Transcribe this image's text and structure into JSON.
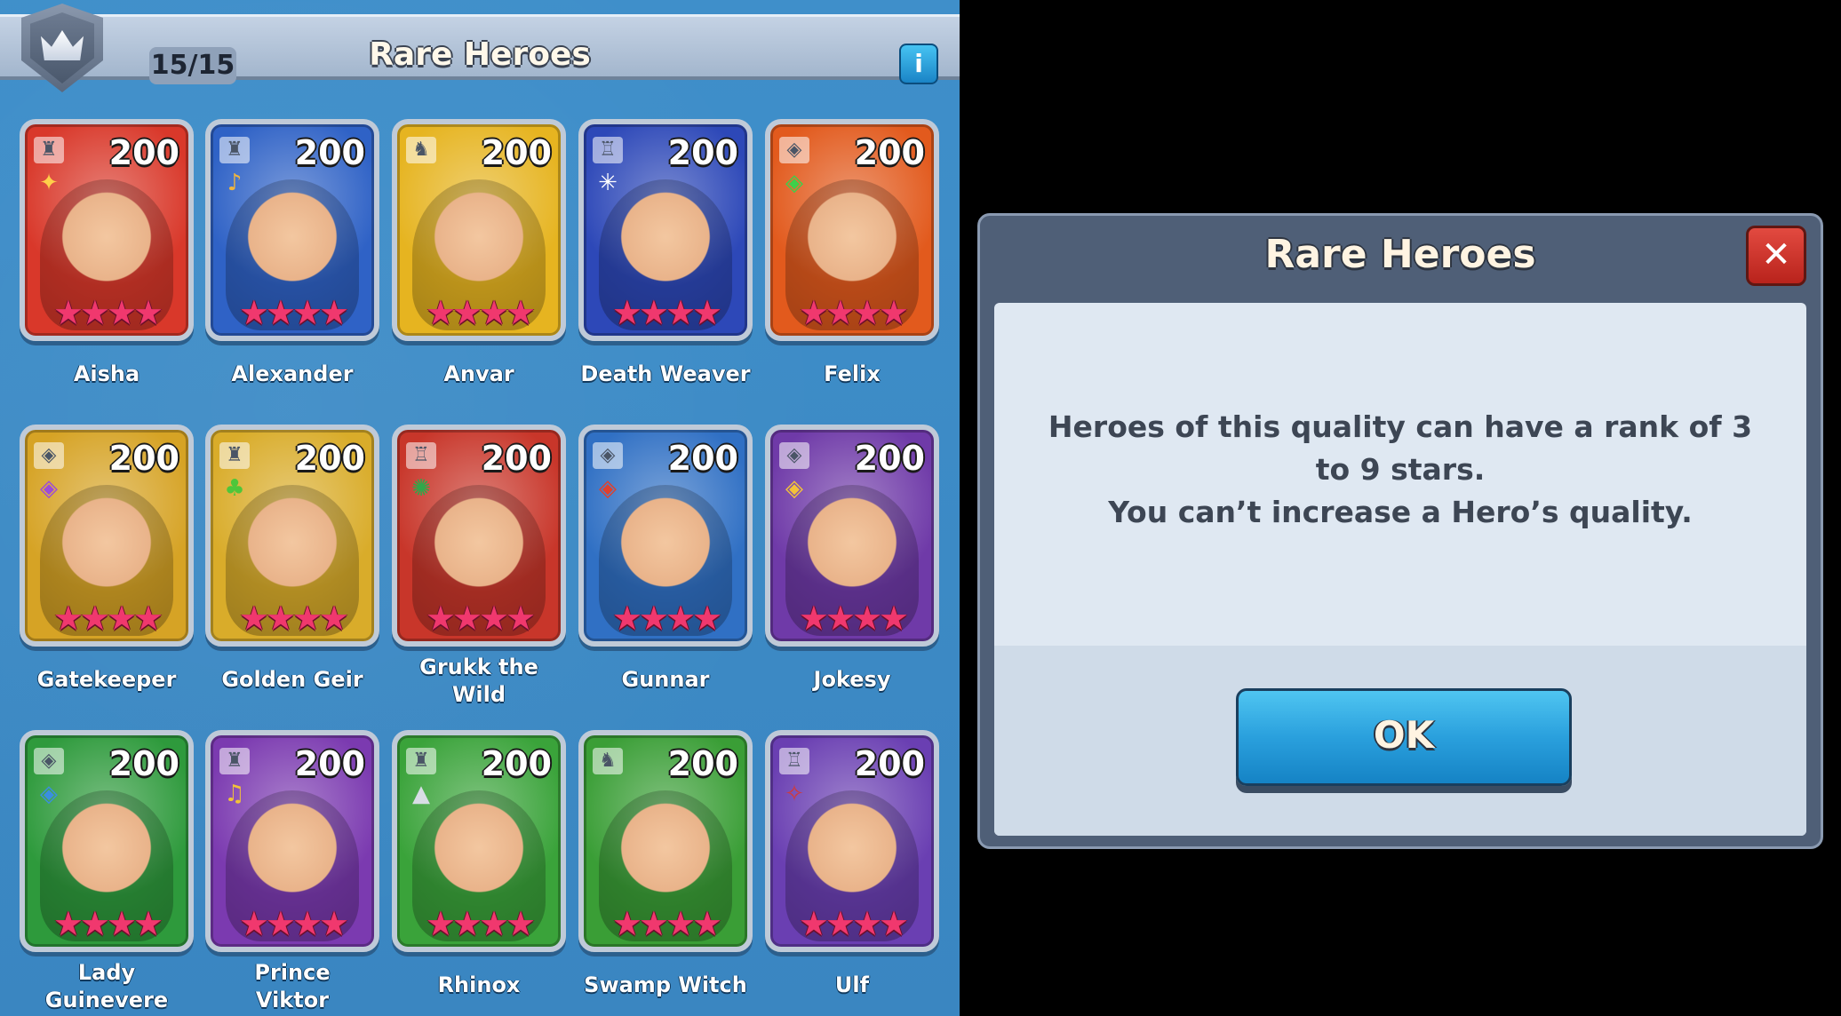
{
  "collection": {
    "title": "Rare Heroes",
    "count": "15/15",
    "info_label": "i",
    "crown_icon": "crown-icon"
  },
  "heroes": [
    {
      "name": "Aisha",
      "power": "200",
      "stars": "★★★★",
      "class_icon": "castle-icon",
      "trait_icon": "sparkle-icon",
      "color": "#d9382a"
    },
    {
      "name": "Alexander",
      "power": "200",
      "stars": "★★★★",
      "class_icon": "castle-icon",
      "trait_icon": "bell-icon",
      "color": "#2f62c6"
    },
    {
      "name": "Anvar",
      "power": "200",
      "stars": "★★★★",
      "class_icon": "knight-icon",
      "trait_icon": "",
      "color": "#e6b420"
    },
    {
      "name": "Death Weaver",
      "power": "200",
      "stars": "★★★★",
      "class_icon": "fortress-icon",
      "trait_icon": "web-icon",
      "color": "#2d48b8"
    },
    {
      "name": "Felix",
      "power": "200",
      "stars": "★★★★",
      "class_icon": "mask-icon",
      "trait_icon": "leaf-mask-icon",
      "color": "#e25a1d"
    },
    {
      "name": "Gatekeeper",
      "power": "200",
      "stars": "★★★★",
      "class_icon": "mask-icon",
      "trait_icon": "purple-mask-icon",
      "color": "#d6a325"
    },
    {
      "name": "Golden Geir",
      "power": "200",
      "stars": "★★★★",
      "class_icon": "castle-icon",
      "trait_icon": "tree-icon",
      "color": "#d9ac2a"
    },
    {
      "name": "Grukk the Wild",
      "power": "200",
      "stars": "★★★★",
      "class_icon": "fortress-icon",
      "trait_icon": "octopus-icon",
      "color": "#c8362a"
    },
    {
      "name": "Gunnar",
      "power": "200",
      "stars": "★★★★",
      "class_icon": "mask-icon",
      "trait_icon": "red-mask-icon",
      "color": "#3070c4"
    },
    {
      "name": "Jokesy",
      "power": "200",
      "stars": "★★★★",
      "class_icon": "mask-icon",
      "trait_icon": "gold-mask-icon",
      "color": "#6f3aa8"
    },
    {
      "name": "Lady Guinevere",
      "power": "200",
      "stars": "★★★★",
      "class_icon": "mask-icon",
      "trait_icon": "blue-mask-icon",
      "color": "#2e9a3c"
    },
    {
      "name": "Prince Viktor",
      "power": "200",
      "stars": "★★★★",
      "class_icon": "castle-icon",
      "trait_icon": "lyre-icon",
      "color": "#7b3ab0"
    },
    {
      "name": "Rhinox",
      "power": "200",
      "stars": "★★★★",
      "class_icon": "castle-icon",
      "trait_icon": "mountain-icon",
      "color": "#3aa33a"
    },
    {
      "name": "Swamp Witch",
      "power": "200",
      "stars": "★★★★",
      "class_icon": "knight-icon",
      "trait_icon": "",
      "color": "#3a9e36"
    },
    {
      "name": "Ulf",
      "power": "200",
      "stars": "★★★★",
      "class_icon": "fortress-icon",
      "trait_icon": "bat-icon",
      "color": "#6a3fb2"
    }
  ],
  "dialog": {
    "title": "Rare Heroes",
    "close_label": "✕",
    "message_line1": "Heroes of this quality can have a rank of 3",
    "message_line2": "to 9 stars.",
    "message_line3": "You can’t increase a Hero’s quality.",
    "ok_label": "OK"
  }
}
